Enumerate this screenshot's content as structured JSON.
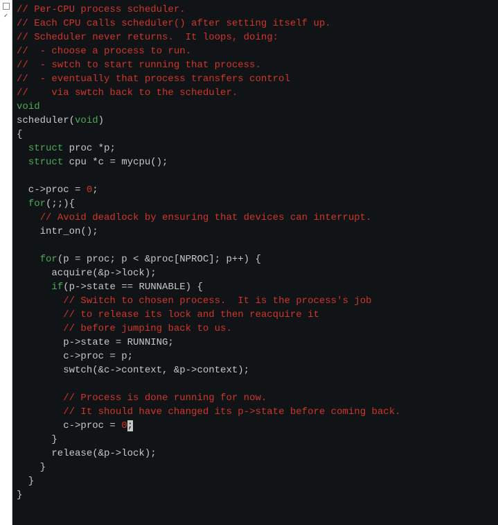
{
  "gutter": {
    "checkbox_title": "checkbox",
    "check_title": "check"
  },
  "code": {
    "c1": "// Per-CPU process scheduler.",
    "c2": "// Each CPU calls scheduler() after setting itself up.",
    "c3": "// Scheduler never returns.  It loops, doing:",
    "c4": "//  - choose a process to run.",
    "c5": "//  - swtch to start running that process.",
    "c6": "//  - eventually that process transfers control",
    "c7": "//    via swtch back to the scheduler.",
    "kw_void1": "void",
    "l9a": "scheduler(",
    "kw_void2": "void",
    "l9b": ")",
    "l10": "{",
    "l11a": "  ",
    "kw_struct1": "struct",
    "l11b": " proc *p;",
    "l12a": "  ",
    "kw_struct2": "struct",
    "l12b": " cpu *c = mycpu();",
    "blank1": "",
    "l14a": "  c->proc = ",
    "num0a": "0",
    "l14b": ";",
    "l15a": "  ",
    "kw_for1": "for",
    "l15b": "(;;){",
    "l16a": "    ",
    "c8": "// Avoid deadlock by ensuring that devices can interrupt.",
    "l17": "    intr_on();",
    "blank2": "",
    "l19a": "    ",
    "kw_for2": "for",
    "l19b": "(p = proc; p < &proc[NPROC]; p++) {",
    "l20": "      acquire(&p->lock);",
    "l21a": "      ",
    "kw_if": "if",
    "l21b": "(p->state == RUNNABLE) {",
    "l22a": "        ",
    "c9": "// Switch to chosen process.  It is the process's job",
    "l23a": "        ",
    "c10": "// to release its lock and then reacquire it",
    "l24a": "        ",
    "c11": "// before jumping back to us.",
    "l25": "        p->state = RUNNING;",
    "l26": "        c->proc = p;",
    "l27": "        swtch(&c->context, &p->context);",
    "blank3": "",
    "l29a": "        ",
    "c12": "// Process is done running for now.",
    "l30a": "        ",
    "c13": "// It should have changed its p->state before coming back.",
    "l31a": "        c->proc = ",
    "num0b": "0",
    "cursor_char": ";",
    "l32": "      }",
    "l33": "      release(&p->lock);",
    "l34": "    }",
    "l35": "  }",
    "l36": "}"
  }
}
